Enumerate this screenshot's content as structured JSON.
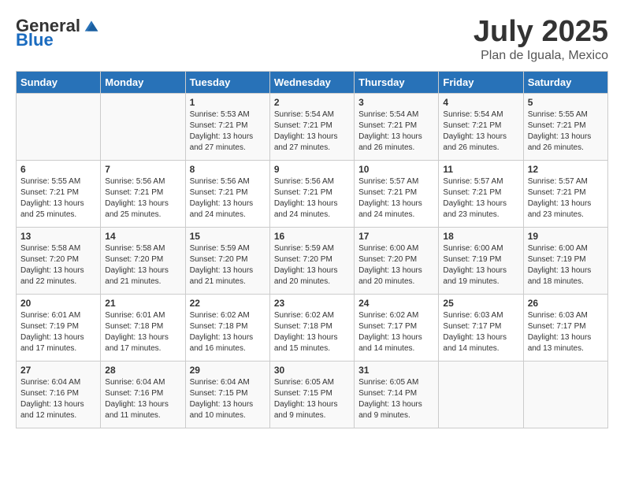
{
  "header": {
    "logo_general": "General",
    "logo_blue": "Blue",
    "month_title": "July 2025",
    "location": "Plan de Iguala, Mexico"
  },
  "days_of_week": [
    "Sunday",
    "Monday",
    "Tuesday",
    "Wednesday",
    "Thursday",
    "Friday",
    "Saturday"
  ],
  "weeks": [
    [
      {
        "day": "",
        "info": ""
      },
      {
        "day": "",
        "info": ""
      },
      {
        "day": "1",
        "info": "Sunrise: 5:53 AM\nSunset: 7:21 PM\nDaylight: 13 hours\nand 27 minutes."
      },
      {
        "day": "2",
        "info": "Sunrise: 5:54 AM\nSunset: 7:21 PM\nDaylight: 13 hours\nand 27 minutes."
      },
      {
        "day": "3",
        "info": "Sunrise: 5:54 AM\nSunset: 7:21 PM\nDaylight: 13 hours\nand 26 minutes."
      },
      {
        "day": "4",
        "info": "Sunrise: 5:54 AM\nSunset: 7:21 PM\nDaylight: 13 hours\nand 26 minutes."
      },
      {
        "day": "5",
        "info": "Sunrise: 5:55 AM\nSunset: 7:21 PM\nDaylight: 13 hours\nand 26 minutes."
      }
    ],
    [
      {
        "day": "6",
        "info": "Sunrise: 5:55 AM\nSunset: 7:21 PM\nDaylight: 13 hours\nand 25 minutes."
      },
      {
        "day": "7",
        "info": "Sunrise: 5:56 AM\nSunset: 7:21 PM\nDaylight: 13 hours\nand 25 minutes."
      },
      {
        "day": "8",
        "info": "Sunrise: 5:56 AM\nSunset: 7:21 PM\nDaylight: 13 hours\nand 24 minutes."
      },
      {
        "day": "9",
        "info": "Sunrise: 5:56 AM\nSunset: 7:21 PM\nDaylight: 13 hours\nand 24 minutes."
      },
      {
        "day": "10",
        "info": "Sunrise: 5:57 AM\nSunset: 7:21 PM\nDaylight: 13 hours\nand 24 minutes."
      },
      {
        "day": "11",
        "info": "Sunrise: 5:57 AM\nSunset: 7:21 PM\nDaylight: 13 hours\nand 23 minutes."
      },
      {
        "day": "12",
        "info": "Sunrise: 5:57 AM\nSunset: 7:21 PM\nDaylight: 13 hours\nand 23 minutes."
      }
    ],
    [
      {
        "day": "13",
        "info": "Sunrise: 5:58 AM\nSunset: 7:20 PM\nDaylight: 13 hours\nand 22 minutes."
      },
      {
        "day": "14",
        "info": "Sunrise: 5:58 AM\nSunset: 7:20 PM\nDaylight: 13 hours\nand 21 minutes."
      },
      {
        "day": "15",
        "info": "Sunrise: 5:59 AM\nSunset: 7:20 PM\nDaylight: 13 hours\nand 21 minutes."
      },
      {
        "day": "16",
        "info": "Sunrise: 5:59 AM\nSunset: 7:20 PM\nDaylight: 13 hours\nand 20 minutes."
      },
      {
        "day": "17",
        "info": "Sunrise: 6:00 AM\nSunset: 7:20 PM\nDaylight: 13 hours\nand 20 minutes."
      },
      {
        "day": "18",
        "info": "Sunrise: 6:00 AM\nSunset: 7:19 PM\nDaylight: 13 hours\nand 19 minutes."
      },
      {
        "day": "19",
        "info": "Sunrise: 6:00 AM\nSunset: 7:19 PM\nDaylight: 13 hours\nand 18 minutes."
      }
    ],
    [
      {
        "day": "20",
        "info": "Sunrise: 6:01 AM\nSunset: 7:19 PM\nDaylight: 13 hours\nand 17 minutes."
      },
      {
        "day": "21",
        "info": "Sunrise: 6:01 AM\nSunset: 7:18 PM\nDaylight: 13 hours\nand 17 minutes."
      },
      {
        "day": "22",
        "info": "Sunrise: 6:02 AM\nSunset: 7:18 PM\nDaylight: 13 hours\nand 16 minutes."
      },
      {
        "day": "23",
        "info": "Sunrise: 6:02 AM\nSunset: 7:18 PM\nDaylight: 13 hours\nand 15 minutes."
      },
      {
        "day": "24",
        "info": "Sunrise: 6:02 AM\nSunset: 7:17 PM\nDaylight: 13 hours\nand 14 minutes."
      },
      {
        "day": "25",
        "info": "Sunrise: 6:03 AM\nSunset: 7:17 PM\nDaylight: 13 hours\nand 14 minutes."
      },
      {
        "day": "26",
        "info": "Sunrise: 6:03 AM\nSunset: 7:17 PM\nDaylight: 13 hours\nand 13 minutes."
      }
    ],
    [
      {
        "day": "27",
        "info": "Sunrise: 6:04 AM\nSunset: 7:16 PM\nDaylight: 13 hours\nand 12 minutes."
      },
      {
        "day": "28",
        "info": "Sunrise: 6:04 AM\nSunset: 7:16 PM\nDaylight: 13 hours\nand 11 minutes."
      },
      {
        "day": "29",
        "info": "Sunrise: 6:04 AM\nSunset: 7:15 PM\nDaylight: 13 hours\nand 10 minutes."
      },
      {
        "day": "30",
        "info": "Sunrise: 6:05 AM\nSunset: 7:15 PM\nDaylight: 13 hours\nand 9 minutes."
      },
      {
        "day": "31",
        "info": "Sunrise: 6:05 AM\nSunset: 7:14 PM\nDaylight: 13 hours\nand 9 minutes."
      },
      {
        "day": "",
        "info": ""
      },
      {
        "day": "",
        "info": ""
      }
    ]
  ]
}
